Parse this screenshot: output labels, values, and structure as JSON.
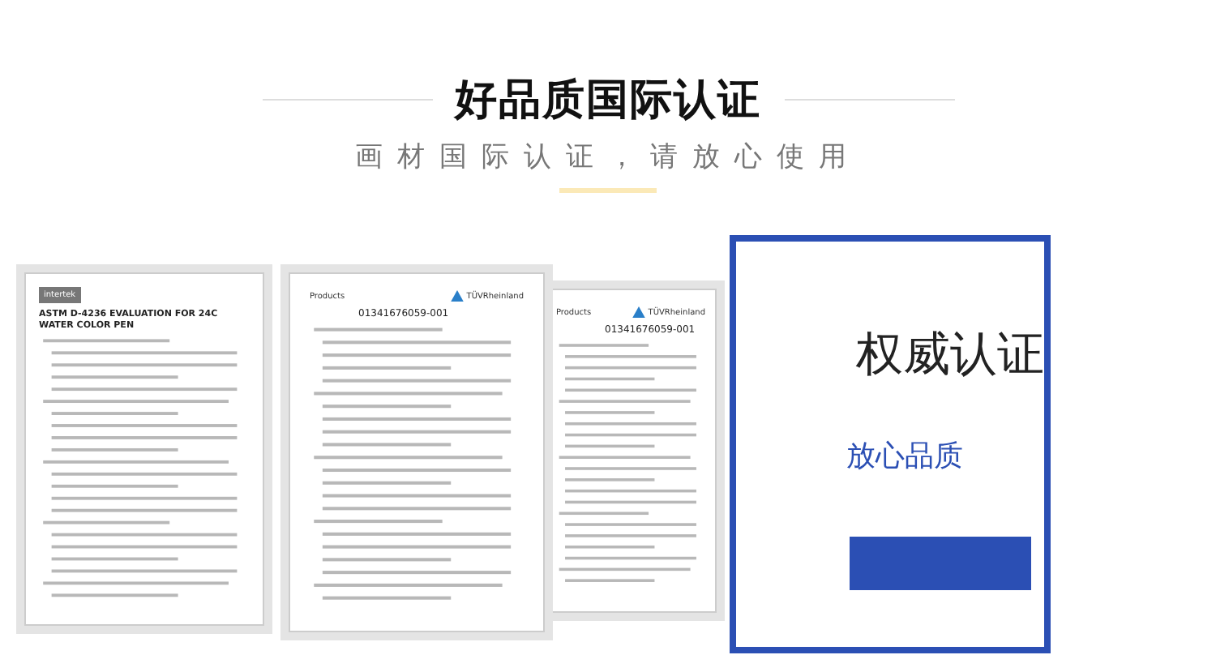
{
  "header": {
    "title": "好品质国际认证",
    "subtitle": "画材国际认证，请放心使用"
  },
  "certificates": [
    {
      "kind": "report",
      "logo": "intertek",
      "heading": "ASTM D-4236 EVALUATION FOR 24C WATER COLOR PEN"
    },
    {
      "kind": "tuv",
      "label": "Products",
      "number": "01341676059-001",
      "logo": "TÜVRheinland"
    },
    {
      "kind": "tuv",
      "label": "Products",
      "number": "01341676059-001",
      "logo": "TÜVRheinland"
    }
  ],
  "badge": {
    "title": "权威认证",
    "subtitle": "放心品质"
  }
}
